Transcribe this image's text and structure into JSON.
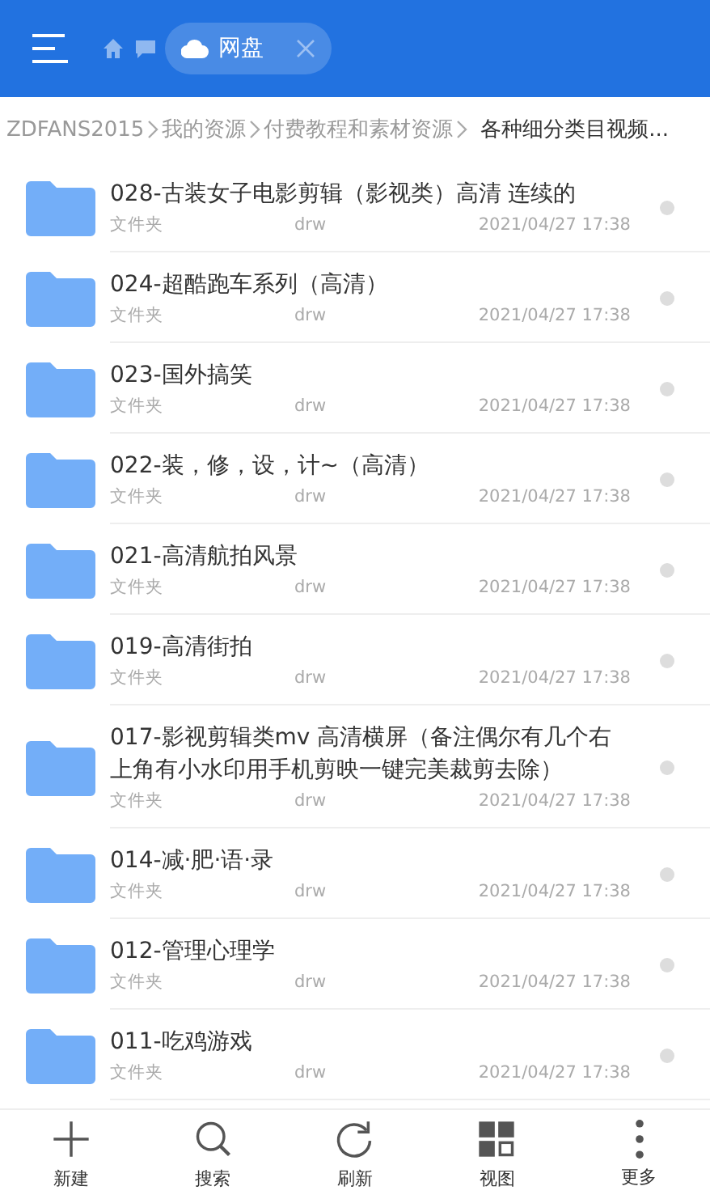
{
  "header": {
    "tab": {
      "label": "网盘",
      "selected": true
    }
  },
  "breadcrumb": [
    "ZDFANS2015",
    "我的资源",
    "付费教程和素材资源",
    "各种细分类目视频..."
  ],
  "files": [
    {
      "name": "028-古装女子电影剪辑（影视类）高清  连续的",
      "type": "文件夹",
      "owner": "drw",
      "modified": "2021/04/27 17:38"
    },
    {
      "name": "024-超酷跑车系列（高清）",
      "type": "文件夹",
      "owner": "drw",
      "modified": "2021/04/27 17:38"
    },
    {
      "name": "023-国外搞笑",
      "type": "文件夹",
      "owner": "drw",
      "modified": "2021/04/27 17:38"
    },
    {
      "name": "022-装，修，设，计~（高清）",
      "type": "文件夹",
      "owner": "drw",
      "modified": "2021/04/27 17:38"
    },
    {
      "name": "021-高清航拍风景",
      "type": "文件夹",
      "owner": "drw",
      "modified": "2021/04/27 17:38"
    },
    {
      "name": "019-高清街拍",
      "type": "文件夹",
      "owner": "drw",
      "modified": "2021/04/27 17:38"
    },
    {
      "name": "017-影视剪辑类mv  高清横屏（备注偶尔有几个右上角有小水印用手机剪映一键完美裁剪去除）",
      "type": "文件夹",
      "owner": "drw",
      "modified": "2021/04/27 17:38"
    },
    {
      "name": "014-减·肥·语·录",
      "type": "文件夹",
      "owner": "drw",
      "modified": "2021/04/27 17:38"
    },
    {
      "name": "012-管理心理学",
      "type": "文件夹",
      "owner": "drw",
      "modified": "2021/04/27 17:38"
    },
    {
      "name": "011-吃鸡游戏",
      "type": "文件夹",
      "owner": "drw",
      "modified": "2021/04/27 17:38"
    }
  ],
  "toolbar": [
    {
      "kind": "new",
      "label": "新建"
    },
    {
      "kind": "search",
      "label": "搜索"
    },
    {
      "kind": "refresh",
      "label": "刷新"
    },
    {
      "kind": "view",
      "label": "视图"
    },
    {
      "kind": "more",
      "label": "更多"
    }
  ]
}
